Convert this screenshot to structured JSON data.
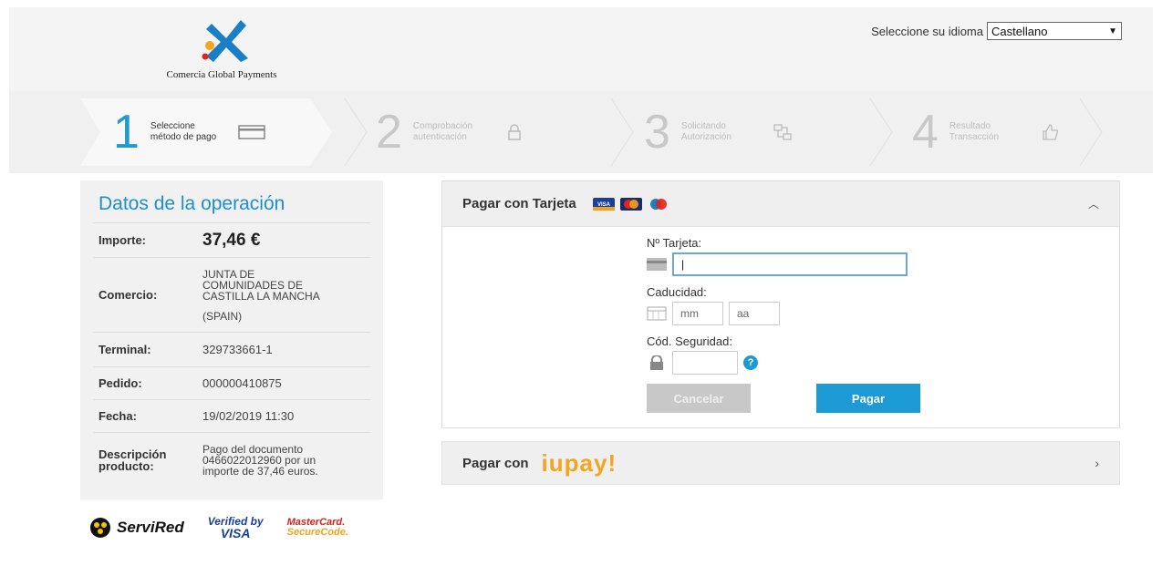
{
  "header": {
    "logo_text": "Comercia Global Payments",
    "language_label": "Seleccione su idioma",
    "language_value": "Castellano"
  },
  "steps": [
    {
      "number": "1",
      "line1": "Seleccione",
      "line2": "método de pago",
      "icon": "card-icon"
    },
    {
      "number": "2",
      "line1": "Comprobación",
      "line2": "autenticación",
      "icon": "lock-icon"
    },
    {
      "number": "3",
      "line1": "Solicitando",
      "line2": "Autorización",
      "icon": "exchange-icon"
    },
    {
      "number": "4",
      "line1": "Resultado",
      "line2": "Transacción",
      "icon": "thumbs-up-icon"
    }
  ],
  "operation": {
    "title": "Datos de la operación",
    "amount_label": "Importe:",
    "amount_value": "37,46 €",
    "merchant_label": "Comercio:",
    "merchant_value_line1": "JUNTA DE",
    "merchant_value_line2": "COMUNIDADES DE",
    "merchant_value_line3": "CASTILLA LA MANCHA",
    "merchant_value_line4": "(SPAIN)",
    "terminal_label": "Terminal:",
    "terminal_value": "329733661-1",
    "order_label": "Pedido:",
    "order_value": "000000410875",
    "date_label": "Fecha:",
    "date_value": "19/02/2019  11:30",
    "desc_label_line1": "Descripción",
    "desc_label_line2": "producto:",
    "desc_value_line1": "Pago del documento",
    "desc_value_line2": "0466022012960 por un",
    "desc_value_line3": "importe de 37,46 euros."
  },
  "badges": {
    "servired": "ServiRed",
    "vbv_line1": "Verified by",
    "vbv_line2": "VISA",
    "mc_line1": "MasterCard.",
    "mc_line2": "SecureCode."
  },
  "card_payment": {
    "title": "Pagar con Tarjeta",
    "card_number_label": "Nº Tarjeta:",
    "card_number_value": "|",
    "expiry_label": "Caducidad:",
    "month_placeholder": "mm",
    "year_placeholder": "aa",
    "cvv_label": "Cód. Seguridad:",
    "cancel_label": "Cancelar",
    "pay_label": "Pagar"
  },
  "iupay": {
    "title": "Pagar con",
    "brand": "iupay!"
  }
}
